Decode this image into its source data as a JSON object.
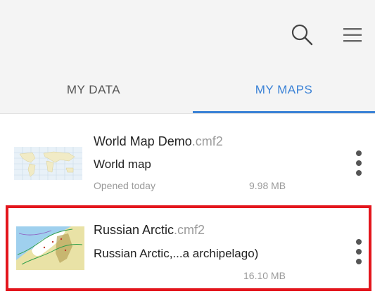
{
  "header": {
    "search_icon": "search-icon",
    "menu_icon": "hamburger-menu-icon"
  },
  "tabs": [
    {
      "label": "MY DATA",
      "active": false
    },
    {
      "label": "MY MAPS",
      "active": true
    }
  ],
  "colors": {
    "accent": "#3b82d6",
    "highlight": "#e3161d",
    "header_bg": "#f4f4f4"
  },
  "maps": [
    {
      "name": "World Map Demo",
      "ext": ".cmf2",
      "description": "World map",
      "opened": "Opened today",
      "size": "9.98 MB",
      "thumbnail": "world-map-thumbnail",
      "more_icon": "more-vertical-icon"
    },
    {
      "name": "Russian Arctic",
      "ext": ".cmf2",
      "description": "Russian Arctic,...a archipelago)",
      "size": "16.10 MB",
      "thumbnail": "arctic-map-thumbnail",
      "more_icon": "more-vertical-icon",
      "highlighted": true
    }
  ]
}
